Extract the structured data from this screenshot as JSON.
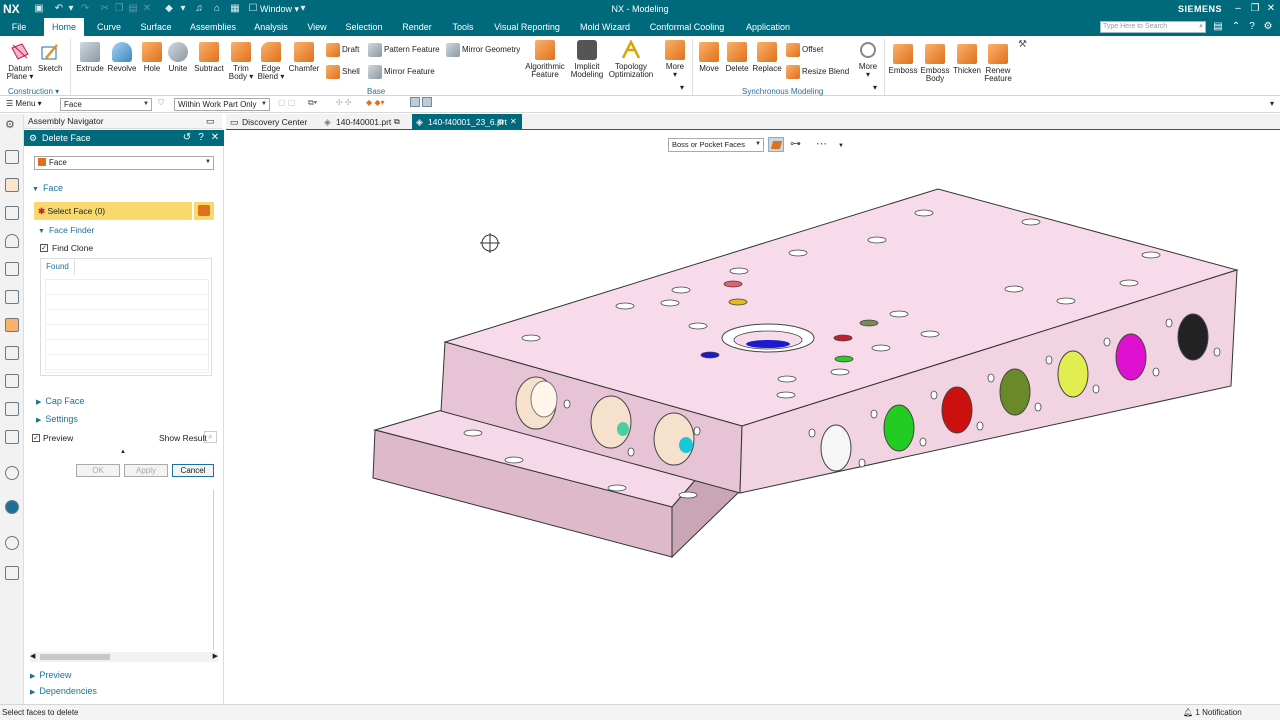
{
  "titlebar": {
    "logo": "NX",
    "window_menu": "Window",
    "title": "NX - Modeling",
    "brand": "SIEMENS"
  },
  "menu": {
    "tabs": [
      "File",
      "Home",
      "Curve",
      "Surface",
      "Assemblies",
      "Analysis",
      "View",
      "Selection",
      "Render",
      "Tools",
      "Visual Reporting",
      "Mold Wizard",
      "Conformal Cooling",
      "Application"
    ],
    "active_tab": "Home",
    "search_placeholder": "Type Here to Search"
  },
  "ribbon": {
    "construction": {
      "datum": "Datum",
      "plane": "Plane",
      "sketch": "Sketch",
      "group": "Construction"
    },
    "base": {
      "extrude": "Extrude",
      "revolve": "Revolve",
      "hole": "Hole",
      "unite": "Unite",
      "subtract": "Subtract",
      "trim1": "Trim",
      "trim2": "Body",
      "edge1": "Edge",
      "edge2": "Blend",
      "chamfer": "Chamfer",
      "draft": "Draft",
      "shell": "Shell",
      "pattern": "Pattern Feature",
      "mirror_feature": "Mirror Feature",
      "mirror_geometry": "Mirror Geometry",
      "algo1": "Algorithmic",
      "algo2": "Feature",
      "implicit1": "Implicit",
      "implicit2": "Modeling",
      "topo1": "Topology",
      "topo2": "Optimization",
      "more": "More",
      "group": "Base"
    },
    "sync": {
      "move": "Move",
      "delete": "Delete",
      "replace": "Replace",
      "offset": "Offset",
      "resize": "Resize Blend",
      "more": "More",
      "group": "Synchronous Modeling"
    },
    "extra": {
      "emboss": "Emboss",
      "emboss_body1": "Emboss",
      "emboss_body2": "Body",
      "thicken": "Thicken",
      "renew1": "Renew",
      "renew2": "Feature"
    }
  },
  "toolbar2": {
    "menu_label": "Menu",
    "filter_value": "Face",
    "scope_value": "Within Work Part Only"
  },
  "navigator": {
    "title": "Assembly Navigator"
  },
  "dialog": {
    "title": "Delete Face",
    "type_value": "Face",
    "face_section": "Face",
    "select_face": "Select Face (0)",
    "face_finder": "Face Finder",
    "find_clone": "Find Clone",
    "found_tab": "Found",
    "cap_face": "Cap Face",
    "settings": "Settings",
    "preview": "Preview",
    "show_result": "Show Result",
    "ok": "OK",
    "apply": "Apply",
    "cancel": "Cancel"
  },
  "lower_panel": {
    "preview": "Preview",
    "dependencies": "Dependencies"
  },
  "graphics_tabs": [
    "Discovery Center",
    "140-f40001.prt",
    "140-f40001_23_6.prt"
  ],
  "active_graphics_tab": 2,
  "view_filter": {
    "value": "Boss or Pocket Faces"
  },
  "status": {
    "prompt": "Select faces to delete",
    "notification": "1 Notification"
  },
  "colors": {
    "brand": "#006a7d",
    "part": "#f6d9e8",
    "highlight": "#f9d96e"
  }
}
